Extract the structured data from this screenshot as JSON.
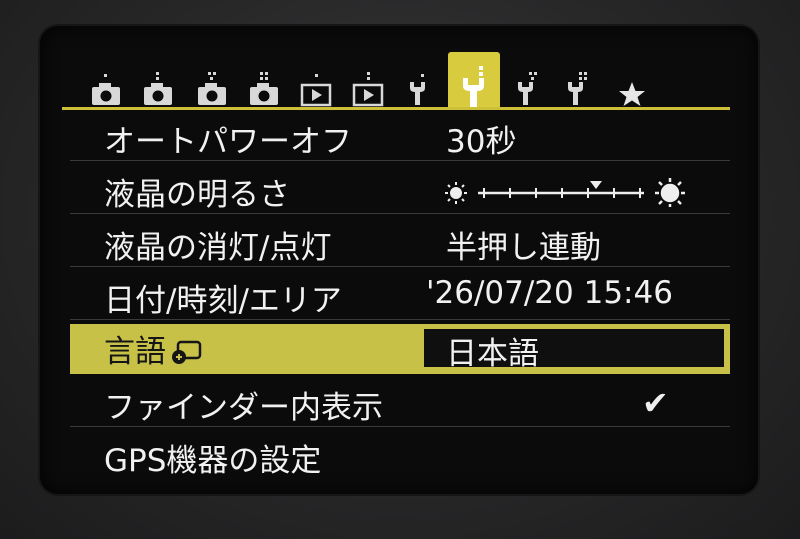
{
  "tabs": [
    {
      "icon": "shooting-camera-icon",
      "dots": 1
    },
    {
      "icon": "shooting-camera-icon",
      "dots": 2
    },
    {
      "icon": "shooting-camera-icon",
      "dots": 3
    },
    {
      "icon": "shooting-camera-icon",
      "dots": 4
    },
    {
      "icon": "playback-icon",
      "dots": 1
    },
    {
      "icon": "playback-icon",
      "dots": 2
    },
    {
      "icon": "setup-wrench-icon",
      "dots": 1
    },
    {
      "icon": "setup-wrench-icon",
      "dots": 2,
      "active": true
    },
    {
      "icon": "setup-wrench-icon",
      "dots": 3
    },
    {
      "icon": "setup-wrench-icon",
      "dots": 4
    },
    {
      "icon": "my-menu-star-icon",
      "dots": 0
    }
  ],
  "menu": {
    "auto_power_off": {
      "label": "オートパワーオフ",
      "value": "30秒"
    },
    "lcd_brightness": {
      "label": "液晶の明るさ",
      "level": 6,
      "levels": 7
    },
    "lcd_off_on": {
      "label": "液晶の消灯/点灯",
      "value": "半押し連動"
    },
    "date_time": {
      "label": "日付/時刻/エリア",
      "value": "'26/07/20 15:46"
    },
    "language": {
      "label": "言語",
      "value": "日本語"
    },
    "viewfinder_display": {
      "label": "ファインダー内表示",
      "value": "✔"
    },
    "gps_settings": {
      "label": "GPS機器の設定"
    }
  },
  "colors": {
    "accent": "#d9cb3e",
    "selected_row": "#c8c148",
    "background": "#0b0b0c",
    "text": "#f1f1f1"
  }
}
